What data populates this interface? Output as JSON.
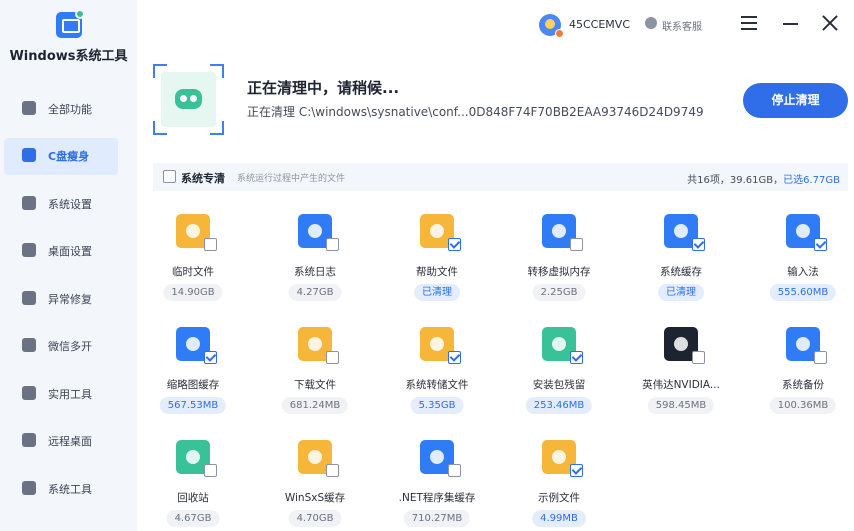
{
  "app": {
    "name": "Windows系统工具",
    "colors": {
      "accent": "#2f6ee8",
      "sidebar_bg": "#f3f6fb"
    }
  },
  "sidebar": {
    "items": [
      {
        "label": "全部功能",
        "icon": "grid-gear-icon",
        "active": false
      },
      {
        "label": "C盘瘦身",
        "icon": "disk-icon",
        "active": true
      },
      {
        "label": "系统设置",
        "icon": "settings-icon",
        "active": false
      },
      {
        "label": "桌面设置",
        "icon": "monitor-icon",
        "active": false
      },
      {
        "label": "异常修复",
        "icon": "repair-icon",
        "active": false
      },
      {
        "label": "微信多开",
        "icon": "wechat-icon",
        "active": false
      },
      {
        "label": "实用工具",
        "icon": "toolbox-icon",
        "active": false
      },
      {
        "label": "远程桌面",
        "icon": "remote-desktop-icon",
        "active": false
      },
      {
        "label": "系统工具",
        "icon": "briefcase-icon",
        "active": false
      }
    ]
  },
  "header": {
    "user_name": "45CCEMVC",
    "service_label": "联系客服"
  },
  "status": {
    "title": "正在清理中，请稍候...",
    "path": "正在清理 C:\\windows\\sysnative\\conf...0D848F74F70BB2EAA93746D24D9749",
    "stop_label": "停止清理"
  },
  "category": {
    "title": "系统专清",
    "description": "系统运行过程中产生的文件",
    "stats_prefix": "共16项，39.61GB，",
    "stats_selected": "已选6.77GB"
  },
  "items": [
    {
      "label": "临时文件",
      "size": "14.90GB",
      "checked": false,
      "selected": false,
      "color": "#f5b63a",
      "icon": "temp-folder-icon"
    },
    {
      "label": "系统日志",
      "size": "4.27GB",
      "checked": false,
      "selected": false,
      "color": "#2f7cf6",
      "icon": "log-window-icon"
    },
    {
      "label": "帮助文件",
      "size": "已清理",
      "checked": true,
      "selected": true,
      "color": "#f5b63a",
      "icon": "help-folder-icon"
    },
    {
      "label": "转移虚拟内存",
      "size": "2.25GB",
      "checked": false,
      "selected": false,
      "color": "#2f7cf6",
      "icon": "chip-icon"
    },
    {
      "label": "系统缓存",
      "size": "已清理",
      "checked": true,
      "selected": true,
      "color": "#2f7cf6",
      "icon": "cache-window-icon"
    },
    {
      "label": "输入法",
      "size": "555.60MB",
      "checked": true,
      "selected": true,
      "color": "#2f7cf6",
      "icon": "input-method-icon"
    },
    {
      "label": "缩略图缓存",
      "size": "567.53MB",
      "checked": true,
      "selected": true,
      "color": "#2f7cf6",
      "icon": "image-folder-icon"
    },
    {
      "label": "下载文件",
      "size": "681.24MB",
      "checked": false,
      "selected": false,
      "color": "#f5b63a",
      "icon": "download-folder-icon"
    },
    {
      "label": "系统转储文件",
      "size": "5.35GB",
      "checked": true,
      "selected": true,
      "color": "#f5b63a",
      "icon": "dump-folder-icon"
    },
    {
      "label": "安装包残留",
      "size": "253.46MB",
      "checked": true,
      "selected": true,
      "color": "#39c297",
      "icon": "package-icon"
    },
    {
      "label": "英伟达NVIDIA...",
      "size": "598.45MB",
      "checked": false,
      "selected": false,
      "color": "#1d2331",
      "icon": "nvidia-icon"
    },
    {
      "label": "系统备份",
      "size": "100.36MB",
      "checked": false,
      "selected": false,
      "color": "#2f7cf6",
      "icon": "backup-window-icon"
    },
    {
      "label": "回收站",
      "size": "4.67GB",
      "checked": false,
      "selected": false,
      "color": "#39c297",
      "icon": "recycle-bin-icon"
    },
    {
      "label": "WinSxS缓存",
      "size": "4.70GB",
      "checked": false,
      "selected": false,
      "color": "#f5b63a",
      "icon": "winsxs-folder-icon"
    },
    {
      "label": ".NET程序集缓存",
      "size": "710.27MB",
      "checked": false,
      "selected": false,
      "color": "#2f7cf6",
      "icon": "dotnet-window-icon"
    },
    {
      "label": "示例文件",
      "size": "4.99MB",
      "checked": true,
      "selected": true,
      "color": "#f5b63a",
      "icon": "sample-folder-icon"
    }
  ]
}
